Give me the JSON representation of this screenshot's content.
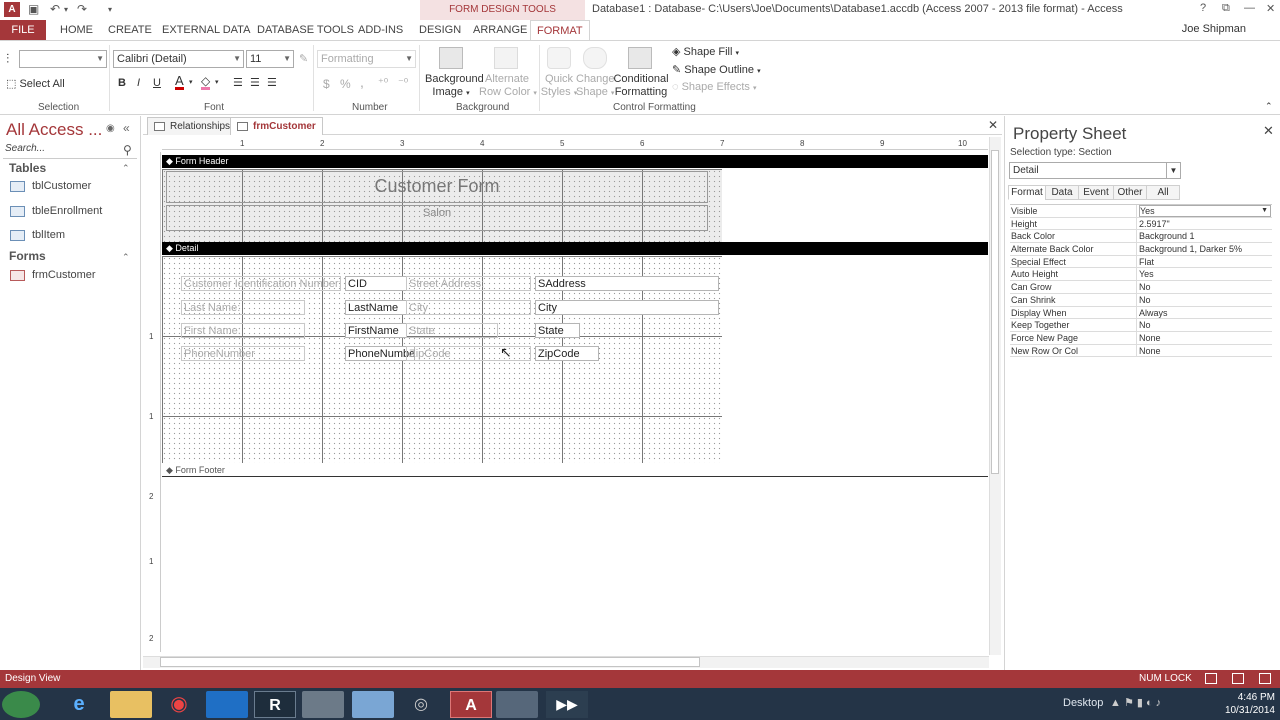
{
  "titlebar": {
    "contextual_group": "FORM DESIGN TOOLS",
    "window_title": "Database1 : Database- C:\\Users\\Joe\\Documents\\Database1.accdb (Access 2007 - 2013 file format) - Access",
    "help": "?",
    "restore_ribbon": "⧉",
    "minimize": "—",
    "maximize": "❐",
    "close": "✕"
  },
  "tabs": {
    "file": "FILE",
    "home": "HOME",
    "create": "CREATE",
    "external": "EXTERNAL DATA",
    "dbtools": "DATABASE TOOLS",
    "addins": "ADD-INS",
    "design": "DESIGN",
    "arrange": "ARRANGE",
    "format": "FORMAT"
  },
  "user": {
    "name": "Joe Shipman"
  },
  "ribbon": {
    "selection": {
      "select_all": "Select All",
      "label": "Selection"
    },
    "font": {
      "family": "Calibri (Detail)",
      "size": "11",
      "label": "Font"
    },
    "number": {
      "format": "Formatting",
      "currency": "$",
      "percent": "%",
      "comma": ",",
      "label": "Number"
    },
    "background": {
      "bg_image_1": "Background",
      "bg_image_2": "Image",
      "alt_row_1": "Alternate",
      "alt_row_2": "Row Color",
      "label": "Background"
    },
    "control_formatting": {
      "quick_1": "Quick",
      "quick_2": "Styles",
      "change_1": "Change",
      "change_2": "Shape",
      "cond_1": "Conditional",
      "cond_2": "Formatting",
      "shape_fill": "Shape Fill",
      "shape_outline": "Shape Outline",
      "shape_effects": "Shape Effects",
      "label": "Control Formatting"
    }
  },
  "nav": {
    "title": "All Access ...",
    "search_placeholder": "Search...",
    "sections": [
      {
        "name": "Tables",
        "items": [
          "tblCustomer",
          "tbleEnrollment",
          "tblItem"
        ]
      },
      {
        "name": "Forms",
        "items": [
          "frmCustomer"
        ]
      }
    ]
  },
  "doc_tabs": {
    "relationships": "Relationships",
    "form": "frmCustomer",
    "close": "✕"
  },
  "rulers": {
    "h": [
      "1",
      "2",
      "3",
      "4",
      "5",
      "6",
      "7",
      "8",
      "9",
      "10"
    ],
    "v": [
      "1",
      "1",
      "2",
      "1",
      "2"
    ]
  },
  "form": {
    "header_bar": "Form Header",
    "title": "Customer Form",
    "subtitle": "Salon",
    "detail_bar": "Detail",
    "footer_bar": "Form Footer",
    "controls": {
      "cust_id_label": "Customer Identification Number:",
      "cid_box": "CID",
      "street_label": "Street Address:",
      "saddress_box": "SAddress",
      "last_label": "Last Name:",
      "lastname_box": "LastName",
      "city_label": "City",
      "city_box": "City",
      "first_label": "First Name:",
      "firstname_box": "FirstName",
      "state_label": "State",
      "state_box": "State",
      "phone_label": "PhoneNumber",
      "phone_box": "PhoneNumber",
      "zip_label": "ZipCode",
      "zip_box": "ZipCode"
    }
  },
  "property_sheet": {
    "title": "Property Sheet",
    "selection_type": "Selection type:  Section",
    "selected": "Detail",
    "tabs": [
      "Format",
      "Data",
      "Event",
      "Other",
      "All"
    ],
    "rows": [
      {
        "k": "Visible",
        "v": "Yes"
      },
      {
        "k": "Height",
        "v": "2.5917\""
      },
      {
        "k": "Back Color",
        "v": "Background 1"
      },
      {
        "k": "Alternate Back Color",
        "v": "Background 1, Darker 5%"
      },
      {
        "k": "Special Effect",
        "v": "Flat"
      },
      {
        "k": "Auto Height",
        "v": "Yes"
      },
      {
        "k": "Can Grow",
        "v": "No"
      },
      {
        "k": "Can Shrink",
        "v": "No"
      },
      {
        "k": "Display When",
        "v": "Always"
      },
      {
        "k": "Keep Together",
        "v": "No"
      },
      {
        "k": "Force New Page",
        "v": "None"
      },
      {
        "k": "New Row Or Col",
        "v": "None"
      }
    ]
  },
  "status": {
    "view": "Design View",
    "numlock": "NUM LOCK"
  },
  "taskbar": {
    "desktop": "Desktop",
    "time": "4:46 PM",
    "date": "10/31/2014"
  },
  "colors": {
    "access_red": "#a4373a",
    "taskbar": "#243447"
  },
  "icons": [
    "access-icon",
    "save-icon",
    "undo-icon",
    "redo-icon",
    "search-icon",
    "chevron-down-icon",
    "close-icon",
    "table-icon",
    "form-icon"
  ]
}
